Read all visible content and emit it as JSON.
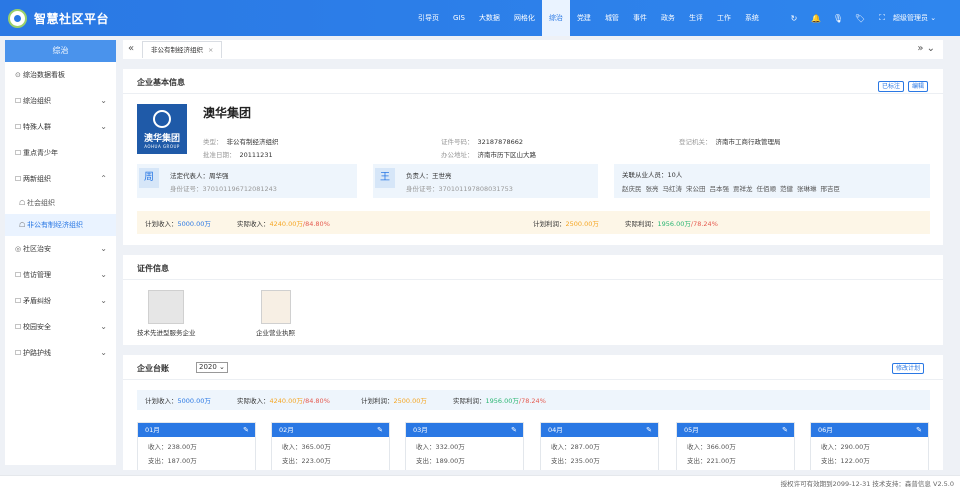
{
  "app": {
    "title": "智慧社区平台"
  },
  "nav": [
    "引导页",
    "GIS",
    "大数据",
    "网格化",
    "综治",
    "党建",
    "城管",
    "事件",
    "政务",
    "生评",
    "工作",
    "系统"
  ],
  "nav_active": 4,
  "tools": [
    "↻",
    "🔔",
    "🎙",
    "🏷",
    "⛶"
  ],
  "user": {
    "name": "超级管理员",
    "caret": "⌄"
  },
  "sidebar": {
    "header": "综治",
    "items": [
      {
        "label": "综治数据看板",
        "icon": "⊙",
        "arrow": ""
      },
      {
        "label": "综治组织",
        "icon": "☐",
        "arrow": "⌄"
      },
      {
        "label": "特殊人群",
        "icon": "☐",
        "arrow": "⌄"
      },
      {
        "label": "重点青少年",
        "icon": "☐",
        "arrow": ""
      },
      {
        "label": "两新组织",
        "icon": "☐",
        "arrow": "⌃"
      }
    ],
    "subitems": [
      {
        "label": "社会组织",
        "icon": "☖"
      },
      {
        "label": "非公有制经济组织",
        "icon": "☖"
      }
    ],
    "items2": [
      {
        "label": "社区治安",
        "icon": "◎",
        "arrow": "⌄"
      },
      {
        "label": "信访管理",
        "icon": "☐",
        "arrow": "⌄"
      },
      {
        "label": "矛盾纠纷",
        "icon": "☐",
        "arrow": "⌄"
      },
      {
        "label": "校园安全",
        "icon": "☐",
        "arrow": "⌄"
      },
      {
        "label": "护路护线",
        "icon": "☐",
        "arrow": "⌄"
      }
    ]
  },
  "tabbar": {
    "left": "«",
    "right": "»  ⌄",
    "tab": "非公有制经济组织",
    "close": "×"
  },
  "basic": {
    "title": "企业基本信息",
    "btn_mark": "已标注",
    "btn_edit": "编辑",
    "logo_cn": "澳华集团",
    "logo_en": "AOHUA GROUP",
    "company": "澳华集团",
    "fields": [
      {
        "k": "类型",
        "v": "非公有制经济组织"
      },
      {
        "k": "证件号码",
        "v": "32187878662"
      },
      {
        "k": "登记机关",
        "v": "济南市工商行政管理局"
      },
      {
        "k": "批准日期",
        "v": "20111231"
      },
      {
        "k": "办公地址",
        "v": "济南市历下区山大路"
      }
    ],
    "legal": {
      "avatar": "周",
      "name": "法定代表人：周华强",
      "id": "身份证号：370101196712081243"
    },
    "charge": {
      "avatar": "王",
      "name": "负责人：王世亮",
      "id": "身份证号：370101197808031753"
    },
    "related": {
      "title": "关联从业人员：10人",
      "names": [
        "赵庆民",
        "张亮",
        "马红涛",
        "宋公田",
        "吕本强",
        "贾祥龙",
        "任佰顺",
        "范健",
        "张琳琳",
        "邢吉臣"
      ]
    },
    "stats": {
      "plan_income_label": "计划收入：",
      "plan_income": "5000.00万",
      "actual_income_label": "实际收入：",
      "actual_income": "4240.00万",
      "actual_income_pct": "/84.80%",
      "plan_profit_label": "计划利润：",
      "plan_profit": "2500.00万",
      "actual_profit_label": "实际利润：",
      "actual_profit": "1956.00万",
      "actual_profit_pct": "/78.24%"
    }
  },
  "certs": {
    "title": "证件信息",
    "items": [
      {
        "caption": "技术先进型服务企业"
      },
      {
        "caption": "企业营业执照"
      }
    ]
  },
  "ledger": {
    "title": "企业台账",
    "year": "2020 ⌄",
    "btn": "修改计划",
    "stats": {
      "plan_income_label": "计划收入：",
      "plan_income": "5000.00万",
      "actual_income_label": "实际收入：",
      "actual_income": "4240.00万",
      "actual_income_pct": "/84.80%",
      "plan_profit_label": "计划利润：",
      "plan_profit": "2500.00万",
      "actual_profit_label": "实际利润：",
      "actual_profit": "1956.00万",
      "actual_profit_pct": "/78.24%"
    },
    "months": [
      {
        "m": "01月",
        "income": "收入：238.00万",
        "expense": "支出：187.00万"
      },
      {
        "m": "02月",
        "income": "收入：365.00万",
        "expense": "支出：223.00万"
      },
      {
        "m": "03月",
        "income": "收入：332.00万",
        "expense": "支出：189.00万"
      },
      {
        "m": "04月",
        "income": "收入：287.00万",
        "expense": "支出：235.00万"
      },
      {
        "m": "05月",
        "income": "收入：366.00万",
        "expense": "支出：221.00万"
      },
      {
        "m": "06月",
        "income": "收入：290.00万",
        "expense": "支出：122.00万"
      }
    ],
    "pen": "✎"
  },
  "footer": "授权许可有效期到2099-12-31  技术支持：森普信息  V2.5.0"
}
